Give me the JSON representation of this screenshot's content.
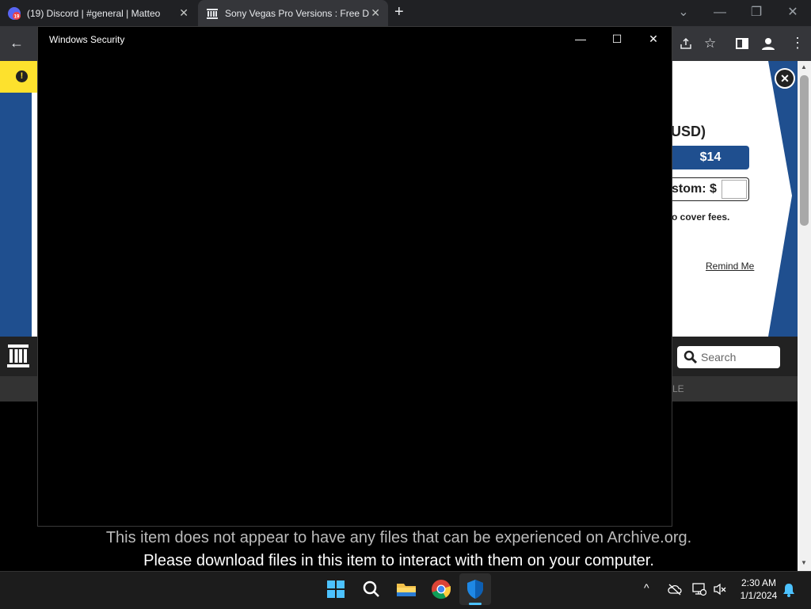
{
  "browser": {
    "tabs": [
      {
        "title": "(19) Discord | #general | Matteo",
        "badge": "19"
      },
      {
        "title": "Sony Vegas Pro Versions : Free D"
      }
    ],
    "new_tab": "+",
    "window_controls": {
      "dropdown": "⌄",
      "minimize": "—",
      "restore": "❐",
      "close": "✕"
    }
  },
  "donation": {
    "currency_label": "USD)",
    "amount_button": "$14",
    "custom_label": "stom: $",
    "fees_text": "o cover fees.",
    "remind_link": "Remind Me",
    "close": "✕"
  },
  "archive_header": {
    "search_placeholder": "Search",
    "nav_partial": "LE"
  },
  "page_message": {
    "line1": "This item does not appear to have any files that can be experienced on Archive.org.",
    "line2": "Please download files in this item to interact with them on your computer."
  },
  "security_window": {
    "title": "Windows Security",
    "minimize": "—",
    "maximize": "☐",
    "close": "✕"
  },
  "taskbar": {
    "time": "2:30 AM",
    "date": "1/1/2024",
    "tray_chevron": "^"
  },
  "colors": {
    "archive_blue": "#1f4f8f",
    "notice_yellow": "#fde12d"
  }
}
